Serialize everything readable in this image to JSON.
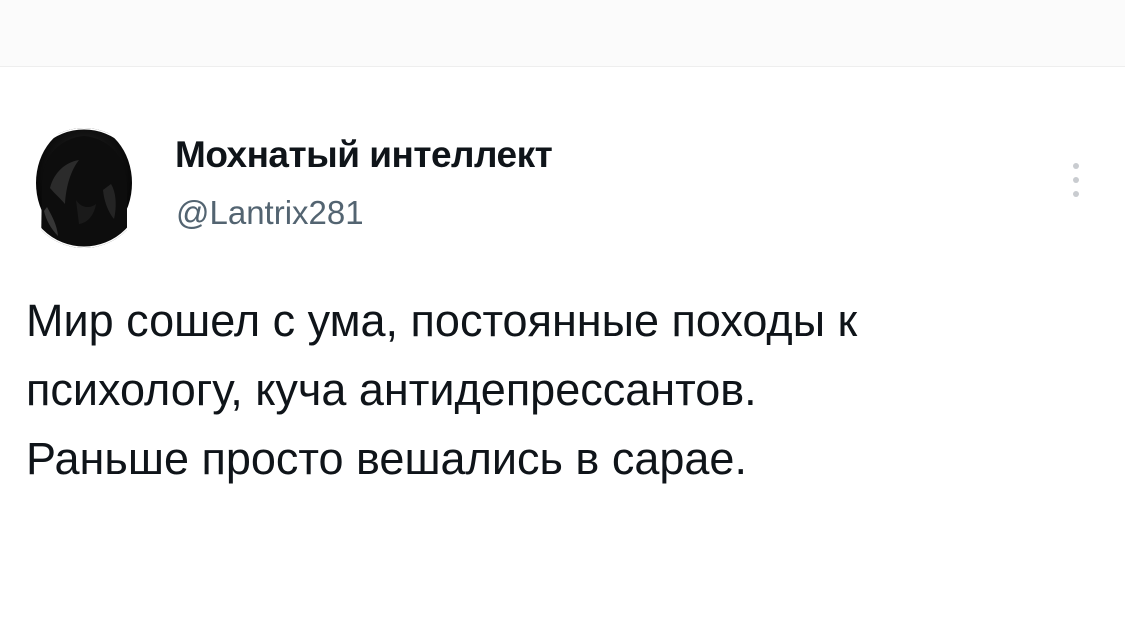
{
  "tweet": {
    "author": {
      "display_name": "Мохнатый интеллект",
      "handle": "@Lantrix281",
      "avatar_icon": "user-photo-avatar"
    },
    "more_menu_icon": "more-vertical-icon",
    "text_lines": [
      "Мир сошел с ума, постоянные походы к",
      "психологу, куча антидепрессантов.",
      "Раньше просто вешались в сарае."
    ]
  },
  "colors": {
    "background": "#ffffff",
    "primary_text": "#0f1419",
    "secondary_text": "#536471",
    "menu_dots": "#c9ccd0"
  }
}
